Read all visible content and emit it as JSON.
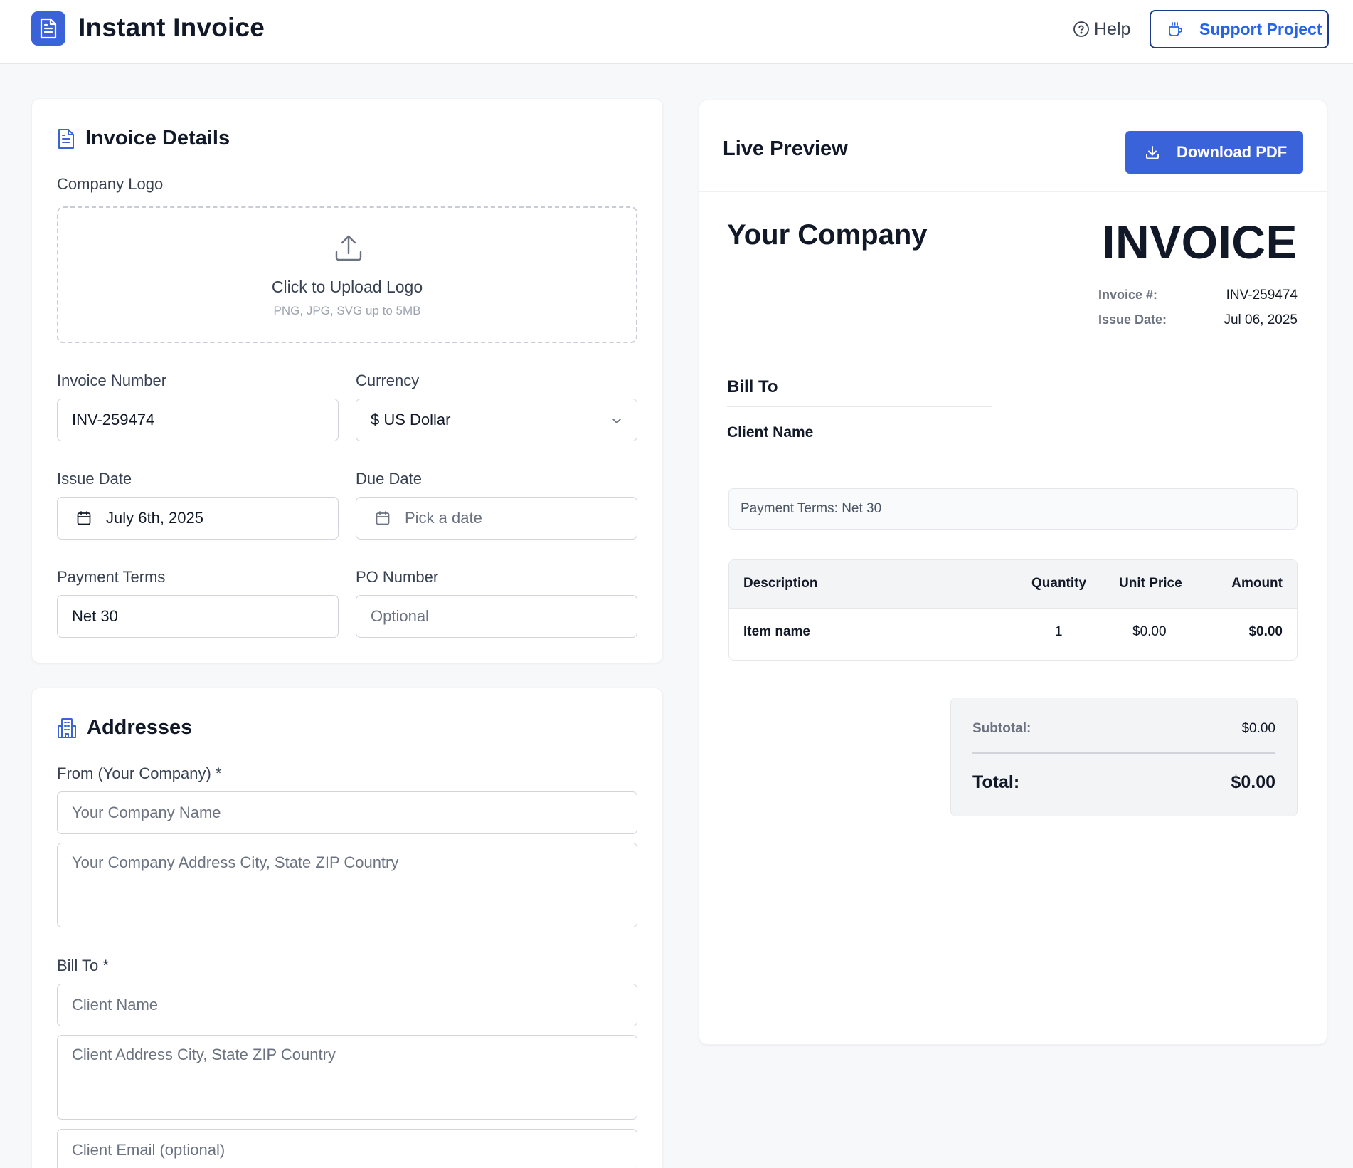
{
  "header": {
    "title": "Instant Invoice",
    "help_label": "Help",
    "support_label": "Support Project"
  },
  "invoice_details": {
    "title": "Invoice Details",
    "logo_label": "Company Logo",
    "upload_title": "Click to Upload Logo",
    "upload_hint": "PNG, JPG, SVG up to 5MB",
    "invoice_number_label": "Invoice Number",
    "invoice_number_value": "INV-259474",
    "currency_label": "Currency",
    "currency_value": "$ US Dollar",
    "issue_date_label": "Issue Date",
    "issue_date_value": "July 6th, 2025",
    "due_date_label": "Due Date",
    "due_date_placeholder": "Pick a date",
    "payment_terms_label": "Payment Terms",
    "payment_terms_value": "Net 30",
    "po_number_label": "PO Number",
    "po_number_placeholder": "Optional"
  },
  "addresses": {
    "title": "Addresses",
    "from_label": "From (Your Company) *",
    "company_name_placeholder": "Your Company Name",
    "company_address_placeholder": "Your Company Address City, State ZIP Country",
    "bill_to_label": "Bill To *",
    "client_name_placeholder": "Client Name",
    "client_address_placeholder": "Client Address City, State ZIP Country",
    "client_email_placeholder": "Client Email (optional)"
  },
  "preview": {
    "title": "Live Preview",
    "download_label": "Download PDF",
    "company_name": "Your Company",
    "invoice_heading": "INVOICE",
    "invoice_no_label": "Invoice #:",
    "invoice_no_value": "INV-259474",
    "issue_date_label": "Issue Date:",
    "issue_date_value": "Jul 06, 2025",
    "bill_to_heading": "Bill To",
    "client_name": "Client Name",
    "payment_terms": "Payment Terms: Net 30",
    "table": {
      "headers": [
        "Description",
        "Quantity",
        "Unit Price",
        "Amount"
      ],
      "rows": [
        [
          "Item name",
          "1",
          "$0.00",
          "$0.00"
        ]
      ]
    },
    "subtotal_label": "Subtotal:",
    "subtotal_value": "$0.00",
    "total_label": "Total:",
    "total_value": "$0.00"
  },
  "colors": {
    "accent": "#3b63d9",
    "support_border": "#1e3a8a",
    "support_text": "#2563eb"
  }
}
